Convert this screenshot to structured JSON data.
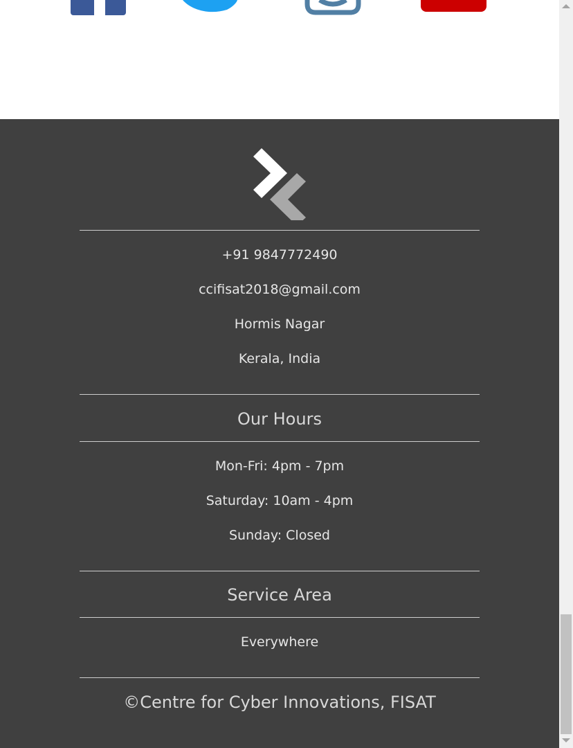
{
  "social": {
    "icons": [
      "facebook-icon",
      "twitter-icon",
      "instagram-icon",
      "youtube-icon"
    ],
    "colors": {
      "facebook": "#3b5998",
      "twitter": "#1da1f2",
      "instagram": "#517fa4",
      "youtube": "#cc0000"
    }
  },
  "footer": {
    "background": "#404040",
    "contact": {
      "phone": "+91 9847772490",
      "email": "ccifisat2018@gmail.com",
      "address_line1": "Hormis Nagar",
      "address_line2": "Kerala, India"
    },
    "hours": {
      "heading": "Our Hours",
      "weekdays": "Mon-Fri: 4pm - 7pm",
      "saturday": "Saturday: 10am - 4pm",
      "sunday": "Sunday: Closed"
    },
    "service_area": {
      "heading": "Service Area",
      "value": "Everywhere"
    },
    "copyright": "©Centre for Cyber Innovations, FISAT"
  }
}
